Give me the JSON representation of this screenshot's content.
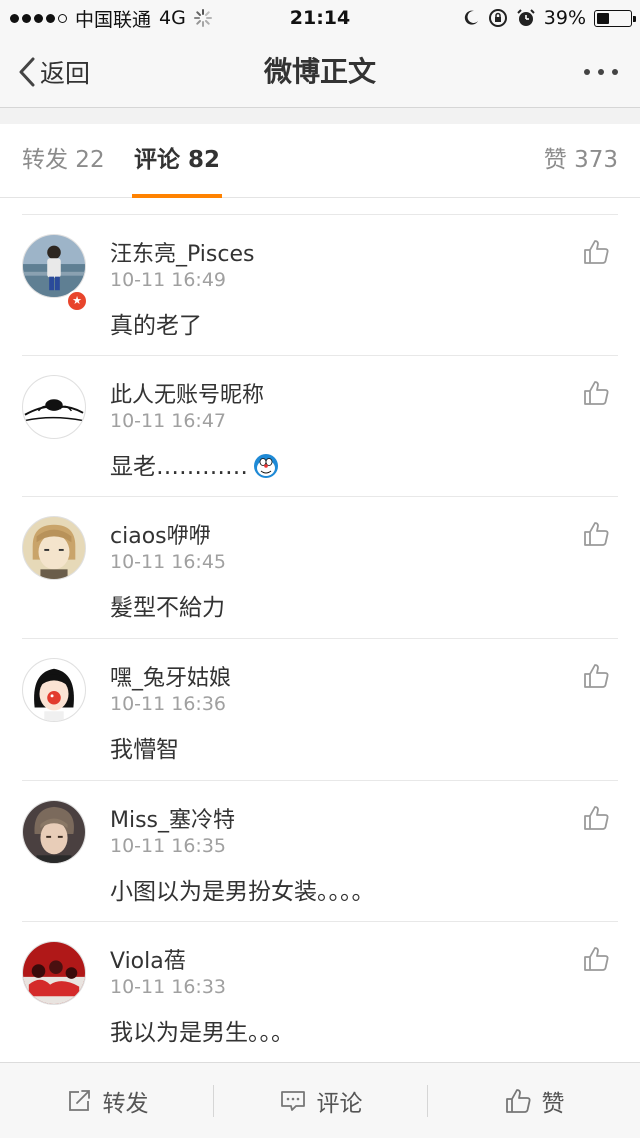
{
  "status_bar": {
    "carrier": "中国联通",
    "network": "4G",
    "time": "21:14",
    "battery": "39%",
    "battery_level": 0.39
  },
  "nav": {
    "back_label": "返回",
    "title": "微博正文"
  },
  "tabs": [
    {
      "label": "转发 22"
    },
    {
      "label": "评论 82"
    },
    {
      "label": "赞 373"
    }
  ],
  "comments": [
    {
      "name": "汪东亮_Pisces",
      "time": "10-11 16:49",
      "text": "真的老了",
      "avatar": "man-by-lake-avatar",
      "badge": true
    },
    {
      "name": "此人无账号昵称",
      "time": "10-11 16:47",
      "text": "显老…………",
      "avatar": "sleeping-sketch-avatar",
      "emoji": "doraemon-emoji"
    },
    {
      "name": "ciaos咿咿",
      "time": "10-11 16:45",
      "text": "髮型不給力",
      "avatar": "anime-boy-avatar"
    },
    {
      "name": "嘿_兔牙姑娘",
      "time": "10-11 16:36",
      "text": "我懵智",
      "avatar": "cartoon-girl-avatar"
    },
    {
      "name": "Miss_塞冷特",
      "time": "10-11 16:35",
      "text": "小图以为是男扮女装。。。。",
      "avatar": "young-man-avatar"
    },
    {
      "name": "Viola蓓",
      "time": "10-11 16:33",
      "text": "我以为是男生。。。",
      "avatar": "red-stage-avatar"
    }
  ],
  "toolbar": {
    "repost_label": "转发",
    "comment_label": "评论",
    "like_label": "赞"
  },
  "colors": {
    "accent": "#ff8200",
    "badge": "#e8452c"
  }
}
